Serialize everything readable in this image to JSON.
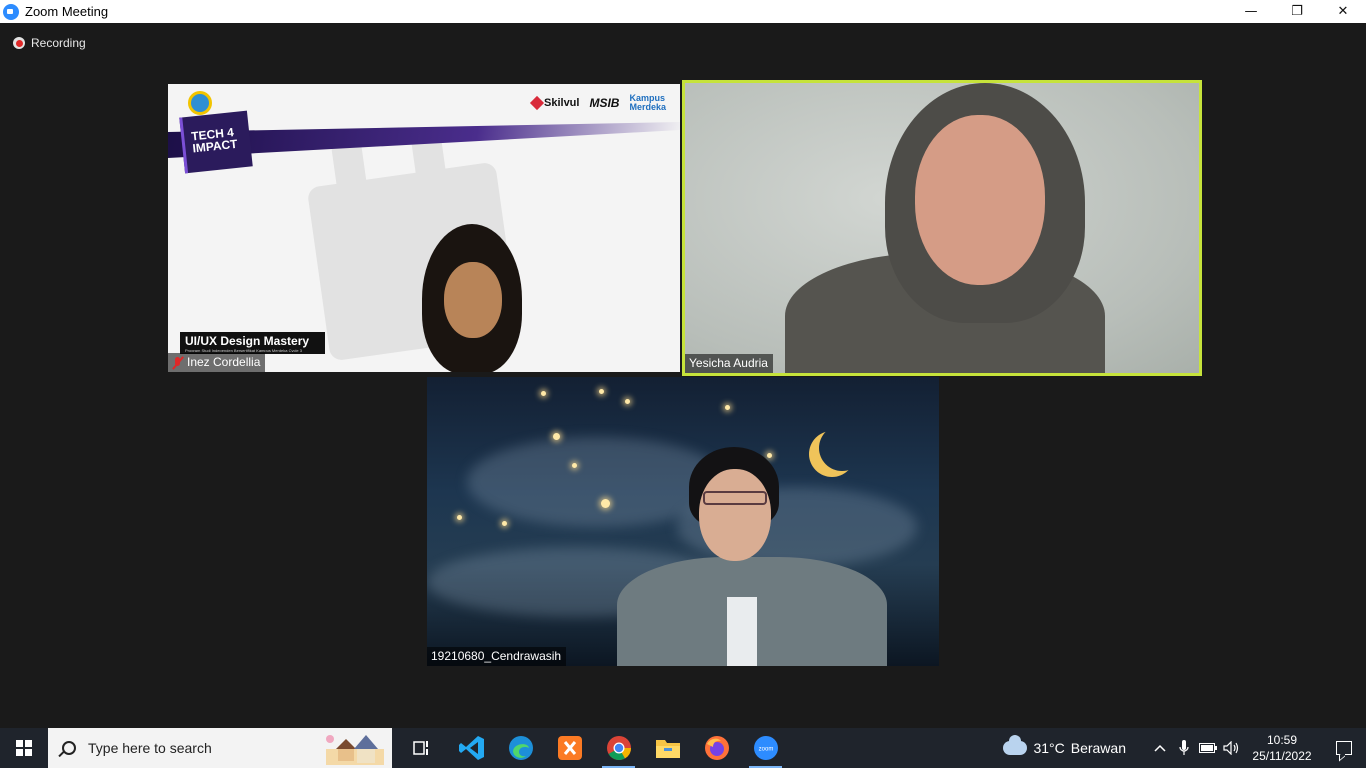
{
  "window": {
    "title": "Zoom Meeting",
    "minimize_glyph": "—",
    "restore_glyph": "❐",
    "close_glyph": "✕"
  },
  "meeting": {
    "recording_label": "Recording",
    "participants": [
      {
        "name": "Inez Cordellia",
        "muted": true,
        "active_speaker": false
      },
      {
        "name": "Yesicha Audria",
        "muted": false,
        "active_speaker": true
      },
      {
        "name": "19210680_Cendrawasih",
        "muted": false,
        "active_speaker": false
      }
    ],
    "slide": {
      "brand_line1": "TECH 4",
      "brand_line2": "IMPACT",
      "partner_1": "Skilvul",
      "partner_2": "MSIB",
      "partner_3_line1": "Kampus",
      "partner_3_line2": "Merdeka",
      "caption_title": "UI/UX Design Mastery",
      "caption_sub": "Program Studi Independen Bersertifikat Kampus Merdeka Cycle 3"
    }
  },
  "taskbar": {
    "search_placeholder": "Type here to search",
    "apps": [
      "task-view",
      "vscode",
      "edge",
      "xampp",
      "chrome",
      "file-explorer",
      "firefox",
      "zoom"
    ],
    "active_apps": [
      "chrome",
      "zoom"
    ],
    "weather_temp": "31°C",
    "weather_desc": "Berawan",
    "time": "10:59",
    "date": "25/11/2022",
    "accent_color": "#2d8cff"
  }
}
